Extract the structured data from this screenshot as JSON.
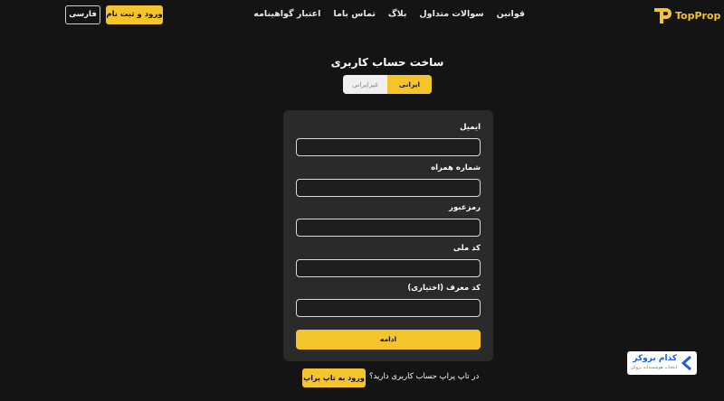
{
  "brand": {
    "name": "TopProp",
    "accent": "#f5c32c"
  },
  "nav": [
    "قوانین",
    "سوالات متداول",
    "بلاگ",
    "تماس باما",
    "اعتبار گواهینامه"
  ],
  "header": {
    "login_label": "ورود و ثبت نام",
    "lang_label": "فارسی"
  },
  "page": {
    "title": "ساخت حساب کاربری"
  },
  "toggle": {
    "iranian": "ایرانی",
    "non_iranian": "غیرایرانی"
  },
  "form": {
    "fields": [
      "ایمیل",
      "شماره همراه",
      "رمزعبور",
      "کد ملی",
      "کد معرف (اختیاری)"
    ],
    "submit_label": "ادامه"
  },
  "footer": {
    "question": "در تاپ پراپ حساب کاربری دارید؟",
    "login_button": "ورود به تاپ پراپ"
  },
  "badge": {
    "title": "کدام بروکر",
    "subtitle": "انتخاب هوشمندانه بروکر"
  }
}
